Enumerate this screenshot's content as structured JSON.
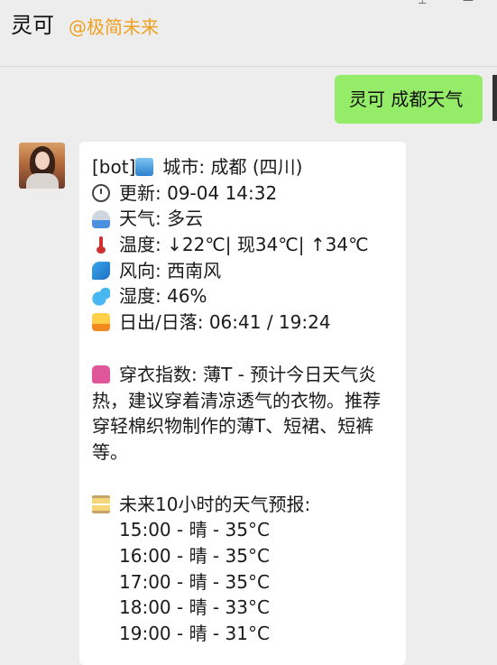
{
  "header": {
    "title": "灵可",
    "subtitle": "@极简未来",
    "icon_1": "pin-icon",
    "icon_2": "minimize-icon"
  },
  "outgoing": {
    "text": "灵可 成都天气"
  },
  "incoming": {
    "line_city": "[bot] ",
    "city": "城市: 成都 (四川)",
    "updated": "更新: 09-04 14:32",
    "weather": "天气: 多云",
    "temperature": "温度: ↓22℃| 现34℃| ↑34℃",
    "wind": "风向: 西南风",
    "humidity": "湿度: 46%",
    "sun": "日出/日落: 06:41 / 19:24",
    "clothing": "穿衣指数: 薄T - 预计今日天气炎热，建议穿着清凉透气的衣物。推荐穿轻棉织物制作的薄T、短裙、短裤等。",
    "forecast_title": "未来10小时的天气预报:",
    "forecast": [
      "15:00 - 晴 - 35°C",
      "16:00 - 晴 - 35°C",
      "17:00 - 晴 - 35°C",
      "18:00 - 晴 - 33°C",
      "19:00 - 晴 - 31°C"
    ]
  },
  "icons": {
    "city": "cityscape-icon",
    "clock": "clock-icon",
    "weather": "cloud-rain-icon",
    "temperature": "thermometer-icon",
    "wind": "wind-icon",
    "humidity": "droplets-icon",
    "sun": "sunrise-icon",
    "clothing": "tshirt-icon",
    "forecast": "hourglass-icon"
  },
  "colors": {
    "background": "#ededed",
    "outgoing_bubble": "#95ec69",
    "incoming_bubble": "#ffffff",
    "subtitle": "#f0a020"
  }
}
